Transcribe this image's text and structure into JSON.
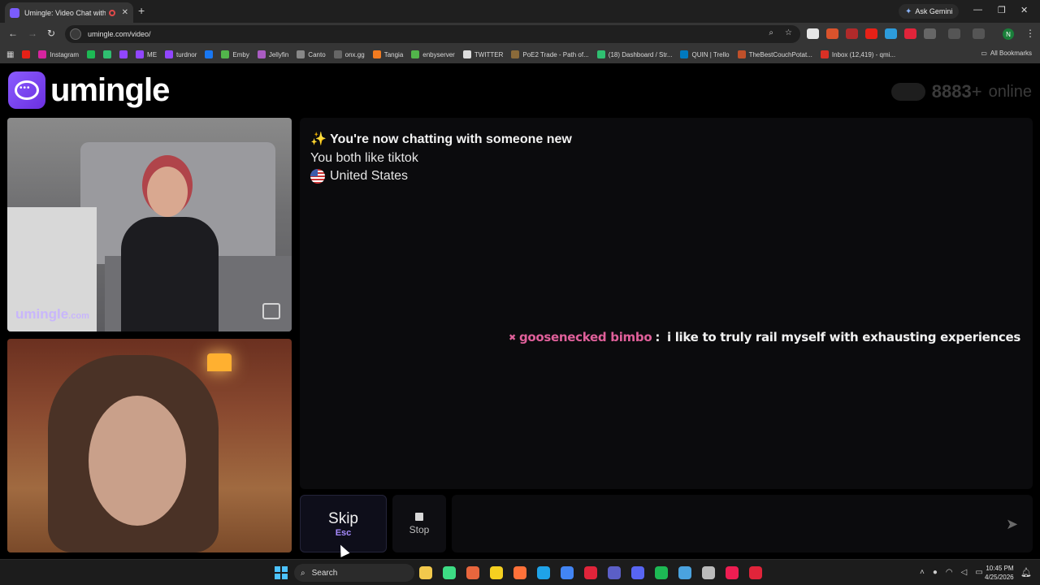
{
  "browser": {
    "tab_title": "Umingle: Video Chat with S",
    "new_tab": "+",
    "ask_gemini": "Ask Gemini",
    "url": "umingle.com/video/",
    "window_controls": [
      "—",
      "❐",
      "✕"
    ],
    "bookmarks": [
      {
        "label": "",
        "color": "#e62117"
      },
      {
        "label": "Instagram",
        "color": "#d6249f"
      },
      {
        "label": "",
        "color": "#1db954"
      },
      {
        "label": "",
        "color": "#2fbf71"
      },
      {
        "label": "",
        "color": "#9146ff"
      },
      {
        "label": "ME",
        "color": "#9146ff"
      },
      {
        "label": "turdnor",
        "color": "#9146ff"
      },
      {
        "label": "",
        "color": "#1877f2"
      },
      {
        "label": "Emby",
        "color": "#52b54b"
      },
      {
        "label": "Jellyfin",
        "color": "#aa5cc3"
      },
      {
        "label": "Canto",
        "color": "#888888"
      },
      {
        "label": "onx.gg",
        "color": "#666666"
      },
      {
        "label": "Tangia",
        "color": "#f27b20"
      },
      {
        "label": "enbyserver",
        "color": "#52b54b"
      },
      {
        "label": "TWITTER",
        "color": "#dddddd"
      },
      {
        "label": "PoE2 Trade - Path of...",
        "color": "#8a6a3a"
      },
      {
        "label": "(18) Dashboard / Str...",
        "color": "#2fbf71"
      },
      {
        "label": "QUIN | Trello",
        "color": "#0079bf"
      },
      {
        "label": "TheBestCouchPotat...",
        "color": "#c0502a"
      },
      {
        "label": "Inbox (12,419) - qmi...",
        "color": "#d93025"
      }
    ],
    "all_bookmarks": "All Bookmarks",
    "profile_initial": "N"
  },
  "header": {
    "brand": "umingle",
    "online_count": "8883",
    "online_suffix": "+",
    "online_label": "online"
  },
  "videos": {
    "watermark_main": "umingle",
    "watermark_suffix": ".com"
  },
  "chat": {
    "system_line1": "✨ You're now chatting with someone new",
    "system_line2": "You both like tiktok",
    "system_country": "United States",
    "messages": [
      {
        "icon": "✖",
        "user": "goosenecked bimbo",
        "separator": ":",
        "text": " i like to truly rail myself with exhausting experiences"
      }
    ]
  },
  "controls": {
    "skip_label": "Skip",
    "skip_key": "Esc",
    "stop_label": "Stop",
    "message_placeholder": "",
    "accent": "#a78bff"
  },
  "taskbar": {
    "search_label": "Search",
    "time": "10:45 PM",
    "date": "4/25/2026",
    "apps": [
      {
        "name": "file-explorer-icon",
        "color": "#f2c94c"
      },
      {
        "name": "green-app-icon",
        "color": "#3ddc84"
      },
      {
        "name": "orange-app-icon",
        "color": "#e8663d"
      },
      {
        "name": "notes-app-icon",
        "color": "#f5d020"
      },
      {
        "name": "firefox-icon",
        "color": "#ff7139"
      },
      {
        "name": "edge-icon",
        "color": "#1fa3e8"
      },
      {
        "name": "chrome-icon",
        "color": "#4285f4"
      },
      {
        "name": "opera-icon",
        "color": "#e0243a"
      },
      {
        "name": "teams-icon",
        "color": "#5b5fc7"
      },
      {
        "name": "discord-icon",
        "color": "#5865f2"
      },
      {
        "name": "spotify-icon",
        "color": "#1db954"
      },
      {
        "name": "notepad-icon",
        "color": "#4aa3df"
      },
      {
        "name": "settings-icon",
        "color": "#bbbbbb"
      },
      {
        "name": "tiktok-icon",
        "color": "#ee1d52"
      },
      {
        "name": "record-icon",
        "color": "#e0243a"
      }
    ]
  }
}
